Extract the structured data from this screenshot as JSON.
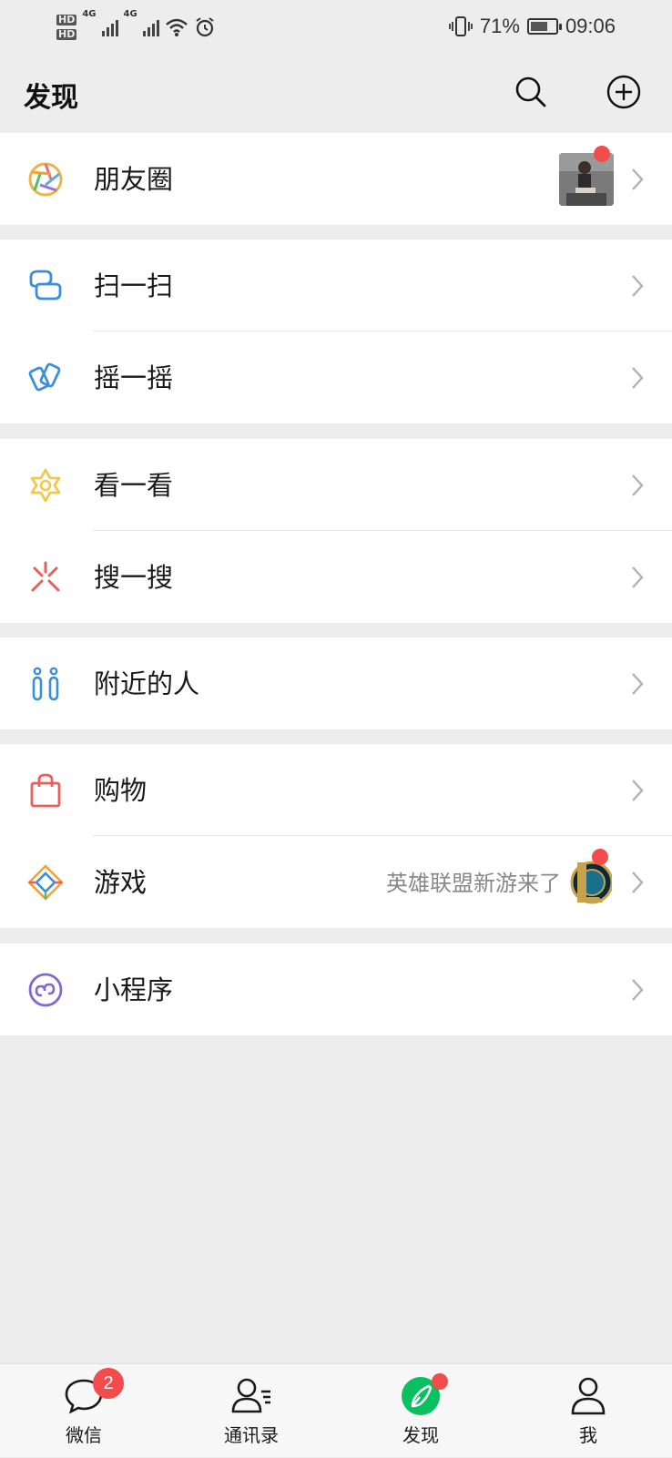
{
  "status_bar": {
    "hd1": "HD",
    "hd2": "HD",
    "sig1_label": "4G",
    "sig2_label": "4G",
    "battery_percent_text": "71%",
    "battery_level": 0.71,
    "time": "09:06"
  },
  "header": {
    "title": "发现",
    "search_icon": "search-icon",
    "add_icon": "add-circle-icon"
  },
  "groups": [
    {
      "items": [
        {
          "label": "朋友圈",
          "icon": "moments-icon",
          "has_thumbnail": true,
          "has_red_dot": true
        }
      ]
    },
    {
      "items": [
        {
          "label": "扫一扫",
          "icon": "scan-icon"
        },
        {
          "label": "摇一摇",
          "icon": "shake-icon"
        }
      ]
    },
    {
      "items": [
        {
          "label": "看一看",
          "icon": "top-stories-icon"
        },
        {
          "label": "搜一搜",
          "icon": "search-sparkle-icon"
        }
      ]
    },
    {
      "items": [
        {
          "label": "附近的人",
          "icon": "people-nearby-icon"
        }
      ]
    },
    {
      "items": [
        {
          "label": "购物",
          "icon": "shopping-bag-icon"
        },
        {
          "label": "游戏",
          "icon": "games-icon",
          "extra_text": "英雄联盟新游来了",
          "has_red_dot": true
        }
      ]
    },
    {
      "items": [
        {
          "label": "小程序",
          "icon": "mini-programs-icon"
        }
      ]
    }
  ],
  "tabbar": {
    "tabs": [
      {
        "label": "微信",
        "icon": "chat-bubble-icon",
        "badge": "2"
      },
      {
        "label": "通讯录",
        "icon": "contacts-icon"
      },
      {
        "label": "发现",
        "icon": "discover-compass-icon",
        "active": true,
        "red_dot": true
      },
      {
        "label": "我",
        "icon": "me-person-icon"
      }
    ]
  },
  "colors": {
    "accent_green": "#07c160",
    "badge_red": "#f24c4c",
    "background": "#ededed"
  }
}
